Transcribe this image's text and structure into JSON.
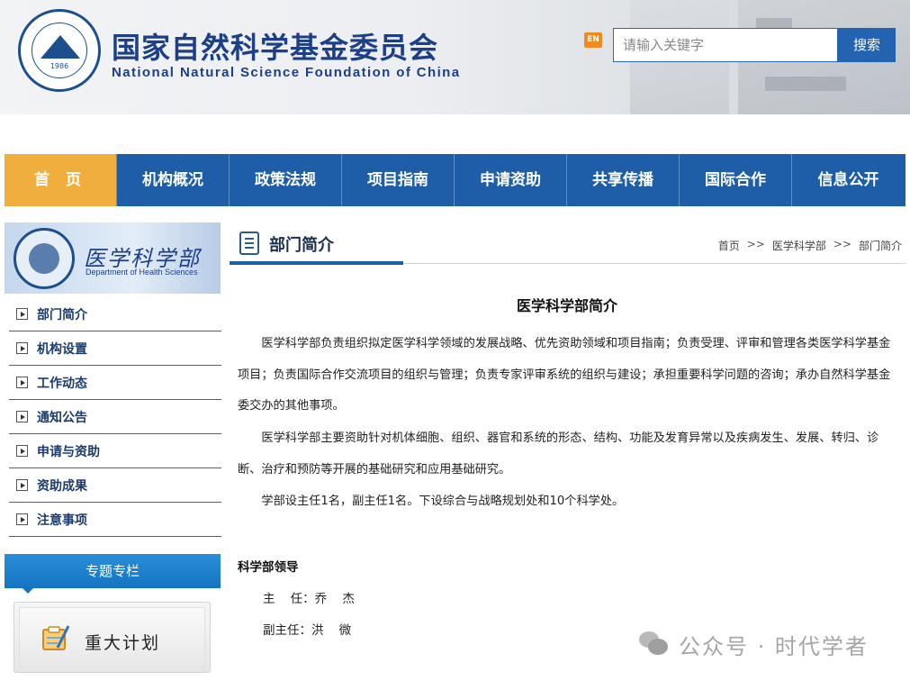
{
  "header": {
    "title_cn": "国家自然科学基金委员会",
    "title_en": "National Natural Science Foundation of China",
    "logo_year": "1986",
    "lang_badge": "EN",
    "search_placeholder": "请输入关键字",
    "search_button": "搜索"
  },
  "nav": {
    "items": [
      {
        "label": "首 页",
        "active": true
      },
      {
        "label": "机构概况"
      },
      {
        "label": "政策法规"
      },
      {
        "label": "项目指南"
      },
      {
        "label": "申请资助"
      },
      {
        "label": "共享传播"
      },
      {
        "label": "国际合作"
      },
      {
        "label": "信息公开"
      }
    ]
  },
  "sidebar": {
    "dept_name_cn": "医学科学部",
    "dept_name_en": "Department of Health Sciences",
    "items": [
      {
        "label": "部门简介"
      },
      {
        "label": "机构设置"
      },
      {
        "label": "工作动态"
      },
      {
        "label": "通知公告"
      },
      {
        "label": "申请与资助"
      },
      {
        "label": "资助成果"
      },
      {
        "label": "注意事项"
      }
    ],
    "special_title": "专题专栏",
    "special_card": "重大计划"
  },
  "main": {
    "section_title": "部门简介",
    "breadcrumb": [
      "首页",
      "医学科学部",
      "部门简介"
    ],
    "breadcrumb_sep": ">>",
    "article_title": "医学科学部简介",
    "paragraphs": [
      "医学科学部负责组织拟定医学科学领域的发展战略、优先资助领域和项目指南；负责受理、评审和管理各类医学科学基金项目；负责国际合作交流项目的组织与管理；负责专家评审系统的组织与建设；承担重要科学问题的咨询；承办自然科学基金委交办的其他事项。",
      "医学科学部主要资助针对机体细胞、组织、器官和系统的形态、结构、功能及发育异常以及疾病发生、发展、转归、诊断、治疗和预防等开展的基础研究和应用基础研究。",
      "学部设主任1名，副主任1名。下设综合与战略规划处和10个科学处。"
    ],
    "leaders_title": "科学部领导",
    "leaders": [
      "主    任：乔    杰",
      "副主任：洪    微"
    ]
  },
  "watermark": {
    "text": "公众号 · 时代学者"
  },
  "colors": {
    "nav_bg": "#1e5ea8",
    "nav_active": "#f0ae3c",
    "title_blue": "#1d3f86",
    "special_head": "#1474c2"
  }
}
